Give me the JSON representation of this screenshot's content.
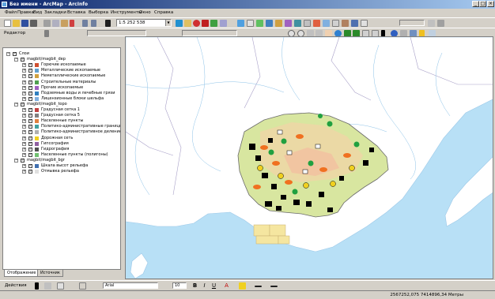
{
  "window": {
    "title": "Без имени - ArcMap - ArcInfo"
  },
  "menu": [
    "Файл",
    "Правка",
    "Вид",
    "Закладки",
    "Вставка",
    "Выборка",
    "Инструменты",
    "Окно",
    "Справка"
  ],
  "toolbar": {
    "scale": "1:5 252 538",
    "editor_label": "Редактор"
  },
  "toc": {
    "root": "Слои",
    "groups": [
      {
        "name": "magbit/magbit_dep",
        "items": [
          "Горючие ископаемые",
          "Металлические ископаемые",
          "Неметаллические ископаемые",
          "Строительные материалы",
          "Прочие ископаемые",
          "Подземные воды и лечебные грязи",
          "Лицензионные блоки шельфа"
        ]
      },
      {
        "name": "magbit/magbit_topo",
        "items": [
          "Градусная сетка 1",
          "Градусная сетка 5",
          "Населенные пункты",
          "Политико-административные границы",
          "Политико-административное деление",
          "Дорожная сеть",
          "Гипсография",
          "Гидрография",
          "Населенные пункты (полигоны)"
        ]
      },
      {
        "name": "magbit/magbit_bgr",
        "items": [
          "Шкала высот рельефа",
          "Отмывка рельефа"
        ]
      }
    ],
    "tabs": [
      "Отображение",
      "Источник"
    ]
  },
  "drawing": {
    "label": "Действия",
    "font": "Arial",
    "size": "10"
  },
  "status": {
    "coords": "2567252,075 7414896,34 Метры"
  }
}
